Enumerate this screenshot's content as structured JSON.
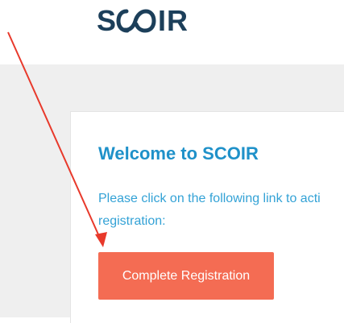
{
  "brand": {
    "name": "SCOIR",
    "color": "#1c3f5a"
  },
  "email": {
    "title": "Welcome to SCOIR",
    "message_line1": "Please click on the following link to acti",
    "message_line2": "registration:",
    "cta_label": "Complete Registration"
  },
  "colors": {
    "title": "#1f91c9",
    "message": "#33a2d6",
    "cta_background": "#f46c53",
    "cta_text": "#ffffff",
    "page_background": "#efefef",
    "annotation_arrow": "#e8392b"
  },
  "annotation": {
    "icon": "red-arrow-pointing-to-button"
  }
}
